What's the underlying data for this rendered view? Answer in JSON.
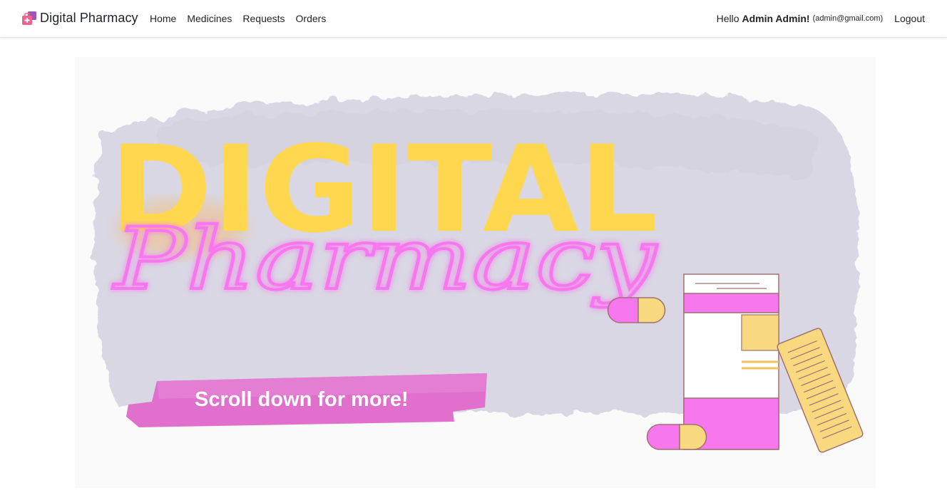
{
  "navbar": {
    "brand": "Digital Pharmacy",
    "links": [
      "Home",
      "Medicines",
      "Requests",
      "Orders"
    ],
    "greeting_prefix": "Hello",
    "user_name": "Admin Admin!",
    "user_email": "(admin@gmail.com)",
    "logout": "Logout"
  },
  "hero": {
    "title_top": "DIGITAL",
    "title_script": "Pharmacy",
    "banner_text": "Scroll down for more!"
  },
  "colors": {
    "yellow": "#ffd84f",
    "pink": "#f778ee",
    "magenta_banner": "#e070cc",
    "wash": "#d8d6e2",
    "pill_yellow": "#f9d97f"
  }
}
